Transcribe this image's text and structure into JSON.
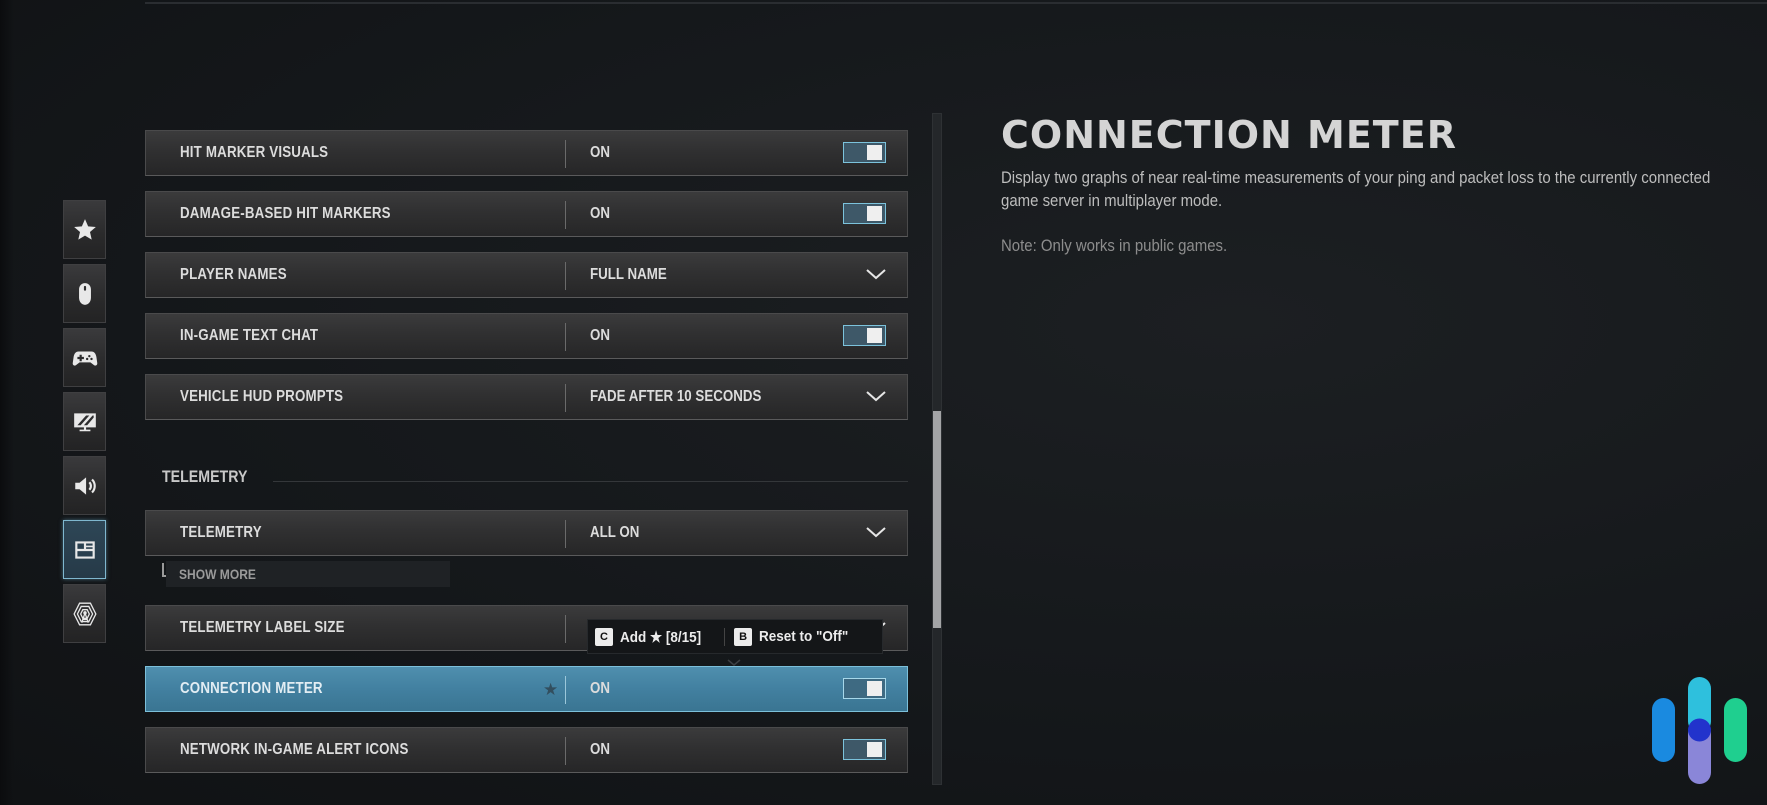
{
  "sidebar": {
    "items": [
      {
        "name": "favorites",
        "icon": "star-icon",
        "active": false
      },
      {
        "name": "mouse-keyboard",
        "icon": "mouse-icon",
        "active": false
      },
      {
        "name": "controller",
        "icon": "gamepad-icon",
        "active": false
      },
      {
        "name": "graphics",
        "icon": "monitor-icon",
        "active": false
      },
      {
        "name": "audio",
        "icon": "speaker-icon",
        "active": false
      },
      {
        "name": "interface",
        "icon": "layout-icon",
        "active": true
      },
      {
        "name": "account-network",
        "icon": "network-tower-icon",
        "active": false
      }
    ]
  },
  "settings": {
    "rows": [
      {
        "label": "HIT MARKER VISUALS",
        "value": "ON",
        "control": "toggle",
        "state": true
      },
      {
        "label": "DAMAGE-BASED HIT MARKERS",
        "value": "ON",
        "control": "toggle",
        "state": true
      },
      {
        "label": "PLAYER NAMES",
        "value": "FULL NAME",
        "control": "dropdown"
      },
      {
        "label": "IN-GAME TEXT CHAT",
        "value": "ON",
        "control": "toggle",
        "state": true
      },
      {
        "label": "VEHICLE HUD PROMPTS",
        "value": "FADE AFTER 10 SECONDS",
        "control": "dropdown"
      }
    ],
    "section_title": "TELEMETRY",
    "telemetry_rows": [
      {
        "label": "TELEMETRY",
        "value": "ALL ON",
        "control": "dropdown"
      },
      {
        "label": "TELEMETRY LABEL SIZE",
        "value": "",
        "control": "dropdown"
      },
      {
        "label": "CONNECTION METER",
        "value": "ON",
        "control": "toggle",
        "state": true,
        "favorite": true,
        "selected": true
      },
      {
        "label": "NETWORK IN-GAME ALERT ICONS",
        "value": "ON",
        "control": "toggle",
        "state": true
      }
    ],
    "show_more": "SHOW MORE"
  },
  "tooltip": {
    "key1": "C",
    "action1": "Add ★ [8/15]",
    "key2": "B",
    "action2": "Reset to \"Off\""
  },
  "scrollbar": {
    "position_fraction": 0.44,
    "visible_fraction": 0.32
  },
  "detail_panel": {
    "title": "CONNECTION METER",
    "description": "Display two graphs of near real-time measurements of your ping and packet loss to the currently connected game server in multiplayer mode.",
    "note": "Note: Only works in public games."
  },
  "logo": {
    "icon": "brand-logo-icon",
    "colors": {
      "left": "#1a8ae0",
      "middle_top": "#2ec0dd",
      "middle_bottom": "#8a86d8",
      "dot": "#2233cc",
      "right": "#1fcf8f"
    }
  },
  "colors": {
    "accent": "#4a88a8",
    "toggle_border": "#7cc3dc",
    "background": "#15181b"
  }
}
